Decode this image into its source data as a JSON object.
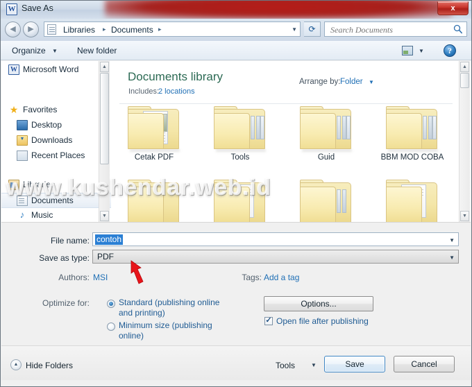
{
  "window": {
    "title": "Save As",
    "app_icon": "word-icon",
    "close_label": "x",
    "accent_red": "#a5201c",
    "library_title_color": "#2c6a54",
    "link_color": "#1f6fb5"
  },
  "address_bar": {
    "crumbs": [
      "Libraries",
      "Documents"
    ],
    "separator": "▸",
    "dropdown_arrow": "▼",
    "refresh_icon": "refresh-icon"
  },
  "search": {
    "placeholder": "Search Documents",
    "value": "",
    "icon": "search-icon"
  },
  "toolbar": {
    "organize_label": "Organize",
    "organize_arrow": "▼",
    "new_folder_label": "New folder",
    "view_icon": "view-layout-icon",
    "view_arrow": "▼",
    "help_icon": "help-icon",
    "help_glyph": "?"
  },
  "sidebar": {
    "items": [
      {
        "label": "Microsoft Word",
        "icon": "word-icon",
        "glyph": "W",
        "selected": false
      },
      {
        "label": "Favorites",
        "icon": "star-icon",
        "glyph": "★",
        "selected": false
      },
      {
        "label": "Desktop",
        "icon": "desktop-icon",
        "glyph": "",
        "selected": false
      },
      {
        "label": "Downloads",
        "icon": "downloads-icon",
        "glyph": "",
        "selected": false
      },
      {
        "label": "Recent Places",
        "icon": "recent-places-icon",
        "glyph": "",
        "selected": false
      },
      {
        "label": "Libraries",
        "icon": "libraries-icon",
        "glyph": "",
        "selected": false
      },
      {
        "label": "Documents",
        "icon": "documents-icon",
        "glyph": "",
        "selected": true
      },
      {
        "label": "Music",
        "icon": "music-icon",
        "glyph": "♪",
        "selected": false
      }
    ],
    "scroll_up": "▲",
    "scroll_down": "▼"
  },
  "file_pane": {
    "library_title": "Documents library",
    "includes_label": "Includes:",
    "includes_value": "2 locations",
    "arrange_label": "Arrange by:",
    "arrange_value": "Folder",
    "arrange_arrow": "▼",
    "folders": [
      {
        "name": "Cetak PDF",
        "type": "folder-with-image"
      },
      {
        "name": "Tools",
        "type": "folder-with-tabs"
      },
      {
        "name": "Guid",
        "type": "folder-with-tabs"
      },
      {
        "name": "BBM MOD COBA",
        "type": "folder-with-tabs"
      }
    ],
    "scroll_up": "▲",
    "scroll_down": "▼"
  },
  "watermark": {
    "text": "www.kushendar.web.id"
  },
  "form": {
    "filename_label": "File name:",
    "filename_value": "contoh",
    "savetype_label": "Save as type:",
    "savetype_value": "PDF",
    "authors_label": "Authors:",
    "authors_value": "MSI",
    "tags_label": "Tags:",
    "tags_value": "Add a tag",
    "optimize_label": "Optimize for:",
    "optimize_options": [
      {
        "label": "Standard (publishing online and printing)",
        "selected": true
      },
      {
        "label": "Minimum size (publishing online)",
        "selected": false
      }
    ],
    "options_button": "Options...",
    "open_after_publishing_label": "Open file after publishing",
    "open_after_publishing_checked": true,
    "combo_arrow": "▼"
  },
  "footer": {
    "hide_folders_label": "Hide Folders",
    "hide_folders_arrow": "▲",
    "tools_label": "Tools",
    "tools_arrow": "▼",
    "save_label": "Save",
    "cancel_label": "Cancel"
  }
}
